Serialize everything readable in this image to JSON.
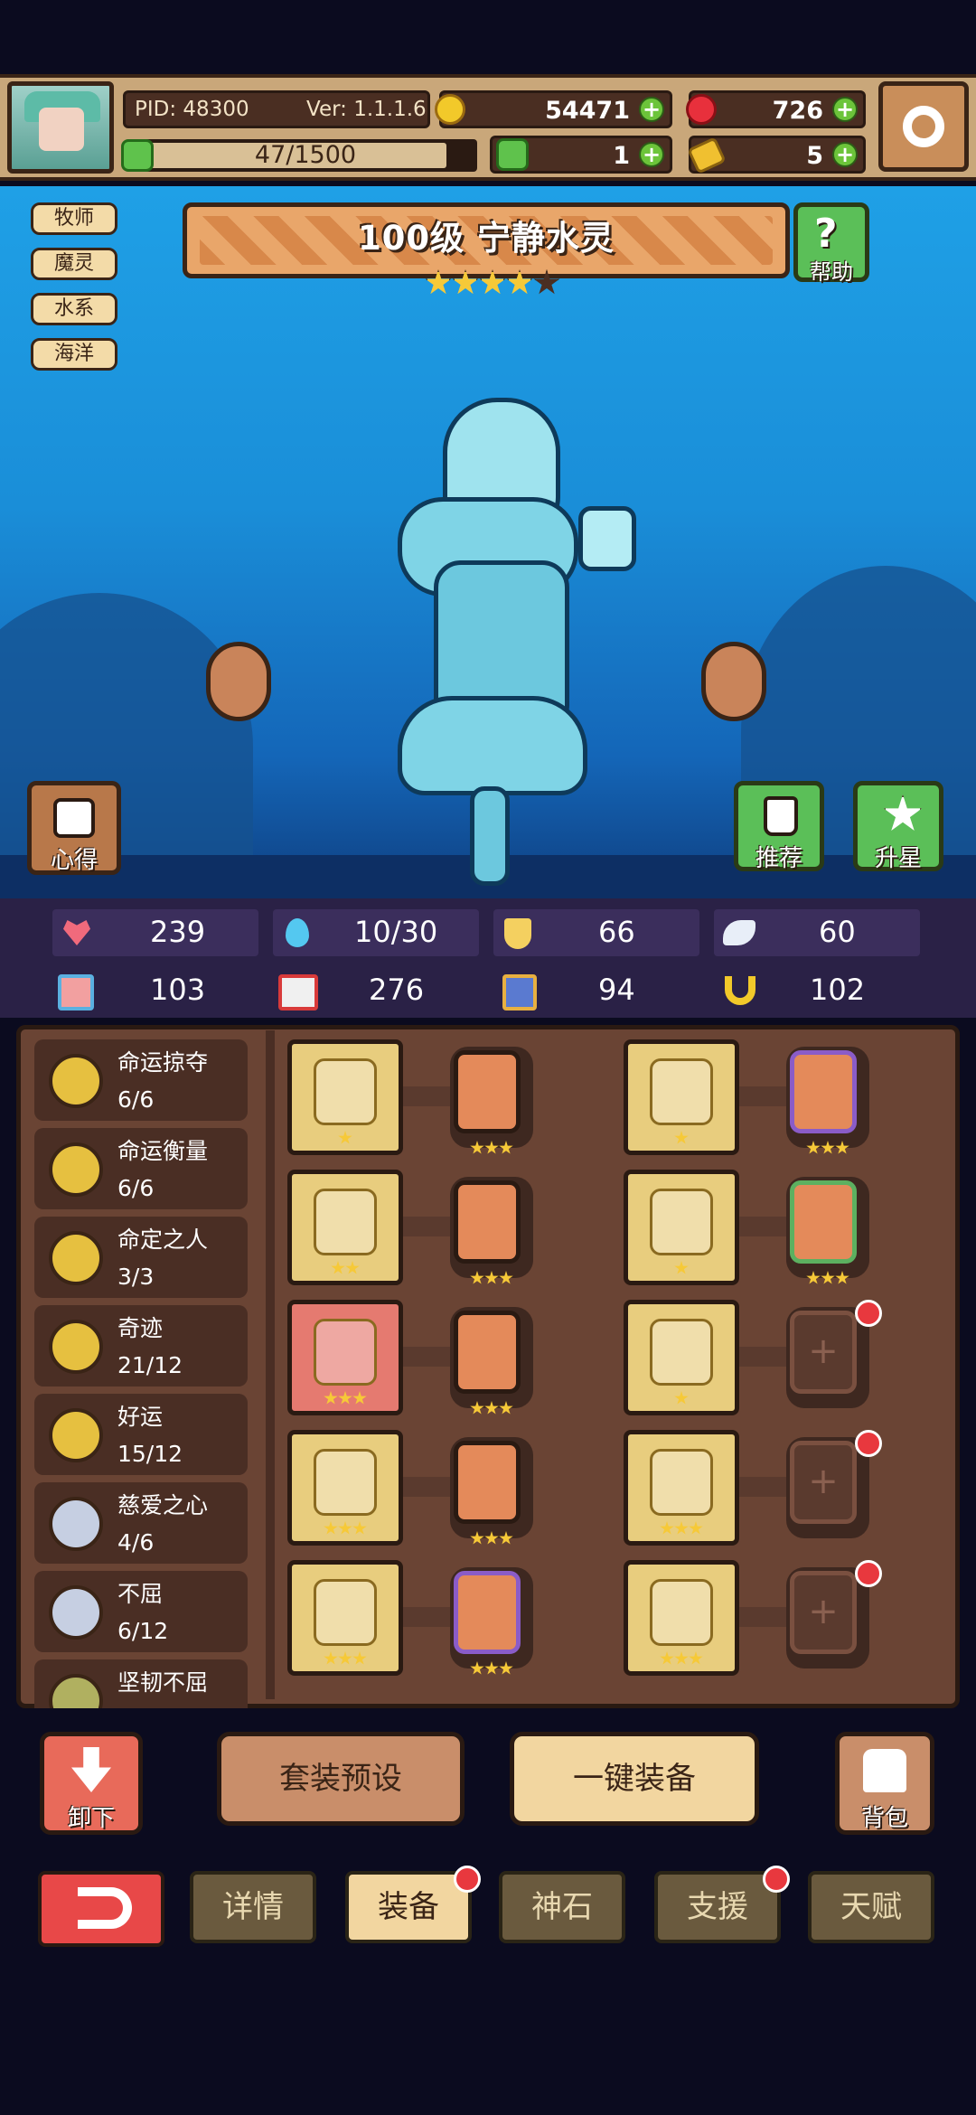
{
  "header": {
    "pid": "PID: 48300",
    "version": "Ver: 1.1.1.6",
    "gold": "54471",
    "gems": "726",
    "exp": "47/1500",
    "clover": "1",
    "keys": "5"
  },
  "tags": [
    "牧师",
    "魔灵",
    "水系",
    "海洋"
  ],
  "hero": {
    "title": "100级  宁静水灵",
    "stars_filled": 4,
    "stars_total": 5,
    "help_label": "帮助"
  },
  "scene_buttons": {
    "notes": "心得",
    "recommend": "推荐",
    "star_up": "升星"
  },
  "stats": [
    {
      "icon": "heart-icon",
      "value": "239"
    },
    {
      "icon": "water-drop-icon",
      "value": "10/30"
    },
    {
      "icon": "shield-icon",
      "value": "66"
    },
    {
      "icon": "wing-icon",
      "value": "60"
    },
    {
      "icon": "portrait-icon",
      "value": "103"
    },
    {
      "icon": "book-icon",
      "value": "276"
    },
    {
      "icon": "flag-icon",
      "value": "94"
    },
    {
      "icon": "horseshoe-icon",
      "value": "102"
    }
  ],
  "sets": [
    {
      "name": "命运掠夺",
      "value": "6/6",
      "color": "gold"
    },
    {
      "name": "命运衡量",
      "value": "6/6",
      "color": "gold"
    },
    {
      "name": "命定之人",
      "value": "3/3",
      "color": "gold"
    },
    {
      "name": "奇迹",
      "value": "21/12",
      "color": "gold"
    },
    {
      "name": "好运",
      "value": "15/12",
      "color": "gold"
    },
    {
      "name": "慈爱之心",
      "value": "4/6",
      "color": "silver"
    },
    {
      "name": "不屈",
      "value": "6/12",
      "color": "silver"
    },
    {
      "name": "坚韧不屈",
      "value": "",
      "color": "green"
    }
  ],
  "equipment": {
    "left": [
      {
        "icon": "scepter-icon",
        "stars": 1,
        "gem": "orange"
      },
      {
        "icon": "vase-icon",
        "stars": 2,
        "gem": "orange"
      },
      {
        "icon": "necklace-icon",
        "stars": 3,
        "gem": "orange"
      },
      {
        "icon": "amulet-icon",
        "stars": 3,
        "gem": "orange"
      },
      {
        "icon": "ring-icon",
        "stars": 3,
        "gem": "purple"
      }
    ],
    "right": [
      {
        "icon": "crown-icon",
        "stars": 1,
        "gem": "purple"
      },
      {
        "icon": "robe-icon",
        "stars": 1,
        "gem": "green"
      },
      {
        "icon": "water-spirit-icon",
        "stars": 1,
        "gem": "empty"
      },
      {
        "icon": "belt-icon",
        "stars": 3,
        "gem": "empty"
      },
      {
        "icon": "boots-icon",
        "stars": 3,
        "gem": "empty"
      }
    ],
    "gem_stars": 3
  },
  "actions": {
    "unequip": "卸下",
    "preset": "套装预设",
    "auto_equip": "一键装备",
    "bag": "背包"
  },
  "nav": {
    "tabs": [
      "详情",
      "装备",
      "神石",
      "支援",
      "天赋"
    ],
    "active": "装备"
  },
  "colors": {
    "accent_red": "#e8383e",
    "panel_brown": "#6a4434",
    "scene_blue": "#1a8ed8"
  }
}
